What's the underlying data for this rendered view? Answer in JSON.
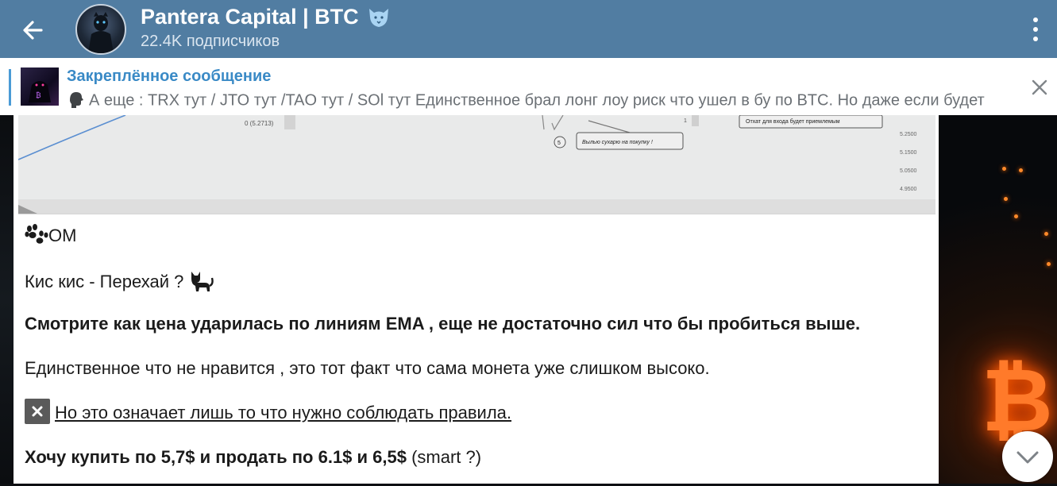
{
  "header": {
    "title": "Pantera Capital | BTC",
    "subtitle": "22.4K подписчиков",
    "bg_color": "#517da2"
  },
  "pinned": {
    "title": "Закреплённое сообщение",
    "text": "А еще :   TRX тут / JTO тут /TAO тут / SOl тут  Единственное брал лонг лоу риск что ушел в бу по BTC. Но даже если будет",
    "accent": "#3a8ac6"
  },
  "chart_image": {
    "left_label": "0 (5.2713)",
    "note_1": "Отхат для входа будет приемлемым",
    "note_2": "Вылью сухарю на покупку !",
    "circle_label": "5",
    "small_label": "1",
    "axis_labels": [
      "5.2500",
      "5.1500",
      "5.0500",
      "4.9500"
    ]
  },
  "message": {
    "line1": "ОМ",
    "line2": "Кис кис - Перехай ?",
    "line3": "Смотрите как цена ударилась по линиям EMA , еще не достаточно сил что бы пробиться выше.",
    "line4": "Единственное что не нравится , это тот факт что сама монета уже слишком высоко.",
    "line5": "Но это означает лишь то что нужно соблюдать правила.",
    "line6_bold": "Хочу купить по 5,7$ и продать по 6.1$ и 6,5$",
    "line6_rest": " (smart ?)"
  },
  "icons": [
    "back-arrow-icon",
    "more-vert-icon",
    "close-icon",
    "paw-icon",
    "cat-icon",
    "cross-mark-icon",
    "speech-head-icon",
    "panther-icon",
    "chevron-down-icon"
  ]
}
